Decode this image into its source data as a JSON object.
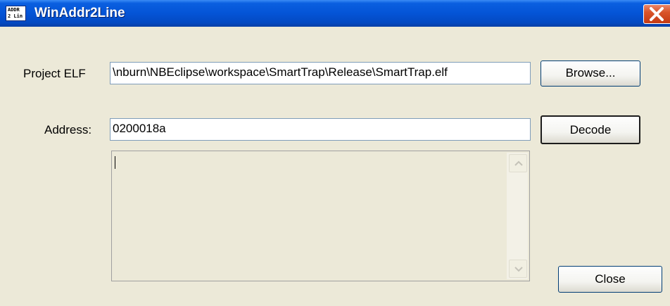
{
  "window": {
    "title": "WinAddr2Line",
    "icon_text": "ADDR\n2 Lin"
  },
  "form": {
    "project_elf_label": "Project ELF",
    "project_elf_value": "\\nburn\\NBEclipse\\workspace\\SmartTrap\\Release\\SmartTrap.elf",
    "address_label": "Address:",
    "address_value": "0200018a",
    "output_value": ""
  },
  "buttons": {
    "browse": "Browse...",
    "decode": "Decode",
    "close": "Close"
  },
  "icons": {
    "app": "addr2line-app-icon",
    "close": "close-icon",
    "scroll_up": "chevron-up-icon",
    "scroll_down": "chevron-down-icon"
  },
  "colors": {
    "titlebar": "#0454d6",
    "close_button": "#d9542a",
    "dialog_background": "#ece9d8"
  }
}
